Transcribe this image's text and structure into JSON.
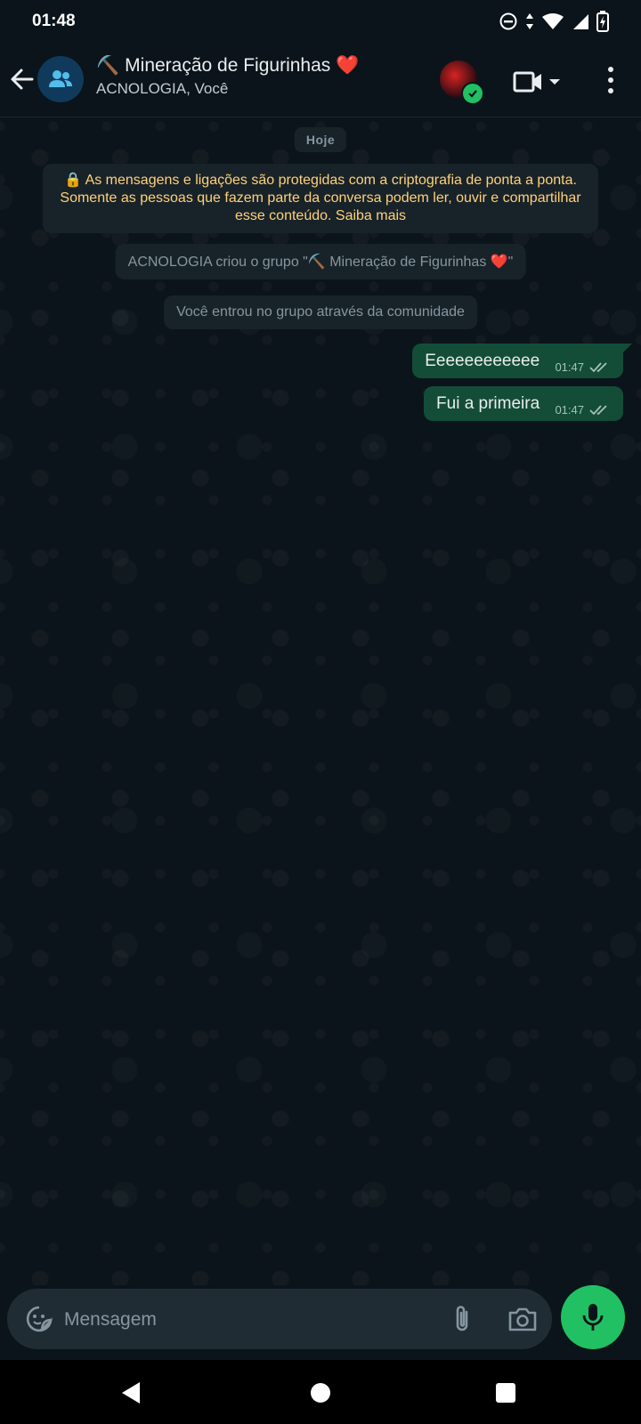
{
  "status_bar": {
    "time": "01:48"
  },
  "header": {
    "title_emoji": "⛏️",
    "title": "Mineração de Figurinhas",
    "title_heart": "❤️",
    "subtitle": "ACNOLOGIA, Você"
  },
  "chat": {
    "date_chip": "Hoje",
    "e2e_notice": "🔒 As mensagens e ligações são protegidas com a criptografia de ponta a ponta. Somente as pessoas que fazem parte da conversa podem ler, ouvir e compartilhar esse conteúdo. Saiba mais",
    "system_messages": [
      "ACNOLOGIA criou o grupo \"⛏️ Mineração de Figurinhas ❤️\"",
      "Você entrou no grupo através da comunidade"
    ],
    "messages": [
      {
        "text": "Eeeeeeeeeeee",
        "time": "01:47",
        "status": "read"
      },
      {
        "text": "Fui a primeira",
        "time": "01:47",
        "status": "read"
      }
    ]
  },
  "composer": {
    "placeholder": "Mensagem"
  },
  "colors": {
    "background": "#0b141a",
    "outgoing_bubble": "#134d37",
    "system_bubble": "#182229",
    "notice_text": "#ffd279",
    "accent_green": "#21c063"
  },
  "icons": {
    "back": "arrow-left-icon",
    "group": "group-icon",
    "video": "video-call-icon",
    "menu": "more-vert-icon",
    "emoji": "sticker-icon",
    "attach": "paperclip-icon",
    "camera": "camera-icon",
    "mic": "microphone-icon"
  }
}
